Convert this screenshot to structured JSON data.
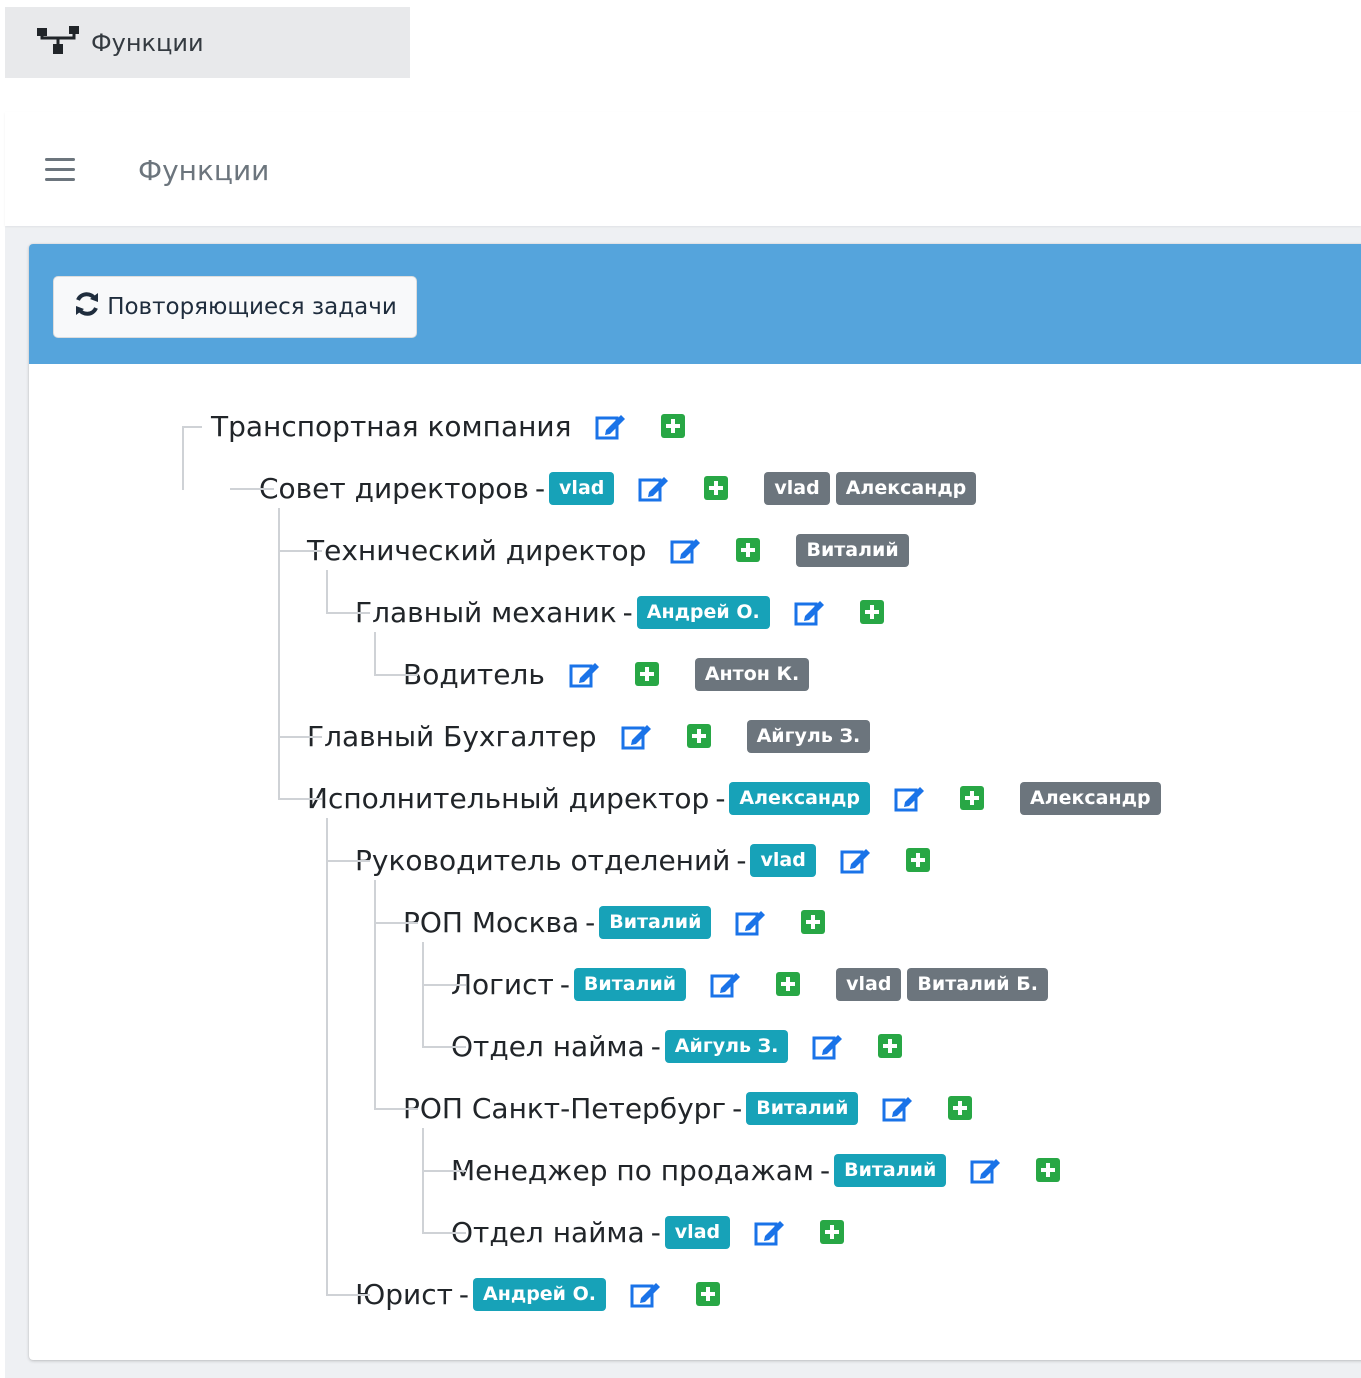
{
  "sidebar": {
    "menu_item": {
      "label": "Функции",
      "icon": "sitemap-icon"
    }
  },
  "navbar": {
    "title": "Функции",
    "menu_icon": "hamburger-icon"
  },
  "card": {
    "repeat_button": {
      "label": "Повторяющиеся задачи",
      "icon": "sync-icon"
    }
  },
  "colors": {
    "header_blue": "#55a4dc",
    "responsible_badge": "#17a2b8",
    "member_badge": "#6c757d",
    "edit_icon": "#1a73e8",
    "add_icon": "#28a745"
  },
  "tree": [
    {
      "name": "Транспортная компания",
      "level": 0,
      "responsible": null,
      "members": []
    },
    {
      "name": "Совет директоров",
      "level": 1,
      "responsible": "vlad",
      "members": [
        "vlad",
        "Александр"
      ]
    },
    {
      "name": "Технический директор",
      "level": 2,
      "responsible": null,
      "members": [
        "Виталий"
      ]
    },
    {
      "name": "Главный механик",
      "level": 3,
      "responsible": "Андрей О.",
      "members": []
    },
    {
      "name": "Водитель",
      "level": 4,
      "responsible": null,
      "members": [
        "Антон К."
      ]
    },
    {
      "name": "Главный Бухгалтер",
      "level": 2,
      "responsible": null,
      "members": [
        "Айгуль З."
      ]
    },
    {
      "name": "Исполнительный директор",
      "level": 2,
      "responsible": "Александр",
      "members": [
        "Александр"
      ]
    },
    {
      "name": "Руководитель отделений",
      "level": 3,
      "responsible": "vlad",
      "members": []
    },
    {
      "name": "РОП Москва",
      "level": 4,
      "responsible": "Виталий",
      "members": []
    },
    {
      "name": "Логист",
      "level": 5,
      "responsible": "Виталий",
      "members": [
        "vlad",
        "Виталий Б."
      ]
    },
    {
      "name": "Отдел найма",
      "level": 5,
      "responsible": "Айгуль З.",
      "members": []
    },
    {
      "name": "РОП Санкт-Петербург",
      "level": 4,
      "responsible": "Виталий",
      "members": []
    },
    {
      "name": "Менеджер по продажам",
      "level": 5,
      "responsible": "Виталий",
      "members": []
    },
    {
      "name": "Отдел найма",
      "level": 5,
      "responsible": "vlad",
      "members": []
    },
    {
      "name": "Юрист",
      "level": 3,
      "responsible": "Андрей О.",
      "members": []
    }
  ]
}
